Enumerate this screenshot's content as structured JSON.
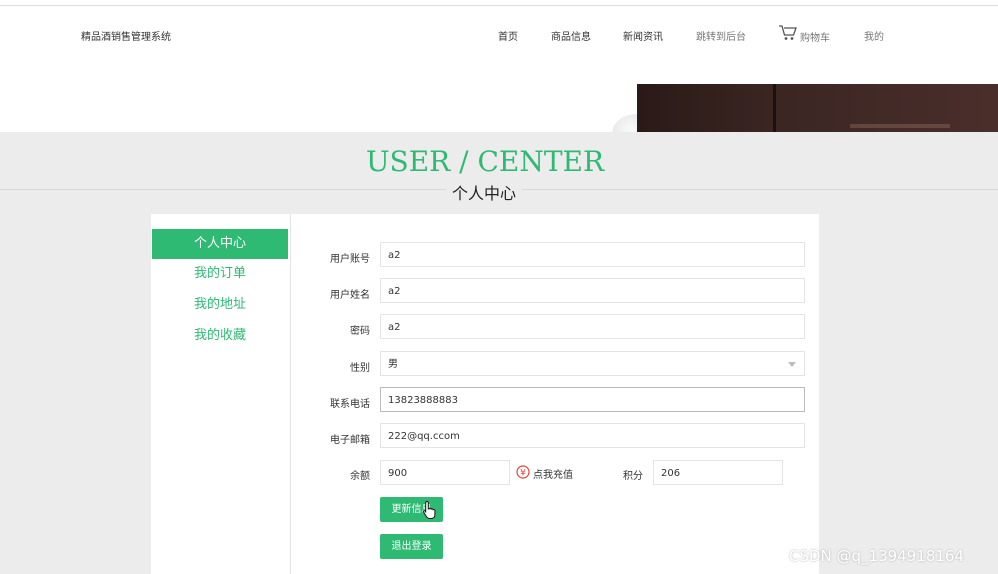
{
  "header": {
    "brand": "精品酒销售管理系统",
    "nav": [
      "首页",
      "商品信息",
      "新闻资讯",
      "跳转到后台"
    ],
    "cart": "购物车",
    "mine": "我的"
  },
  "section": {
    "title_en": "USER / CENTER",
    "title_cn": "个人中心"
  },
  "sidebar": {
    "items": [
      {
        "label": "个人中心"
      },
      {
        "label": "我的订单"
      },
      {
        "label": "我的地址"
      },
      {
        "label": "我的收藏"
      }
    ]
  },
  "form": {
    "account_label": "用户账号",
    "account_value": "a2",
    "name_label": "用户姓名",
    "name_value": "a2",
    "password_label": "密码",
    "password_value": "a2",
    "gender_label": "性别",
    "gender_value": "男",
    "phone_label": "联系电话",
    "phone_value": "13823888883",
    "email_label": "电子邮箱",
    "email_value": "222@qq.ccom",
    "balance_label": "余额",
    "balance_value": "900",
    "recharge_label": "点我充值",
    "points_label": "积分",
    "points_value": "206",
    "update_button": "更新信息",
    "logout_button": "退出登录"
  },
  "watermark": "CSDN @q_1394918164",
  "colors": {
    "accent": "#2fba74",
    "background": "#ececec"
  }
}
